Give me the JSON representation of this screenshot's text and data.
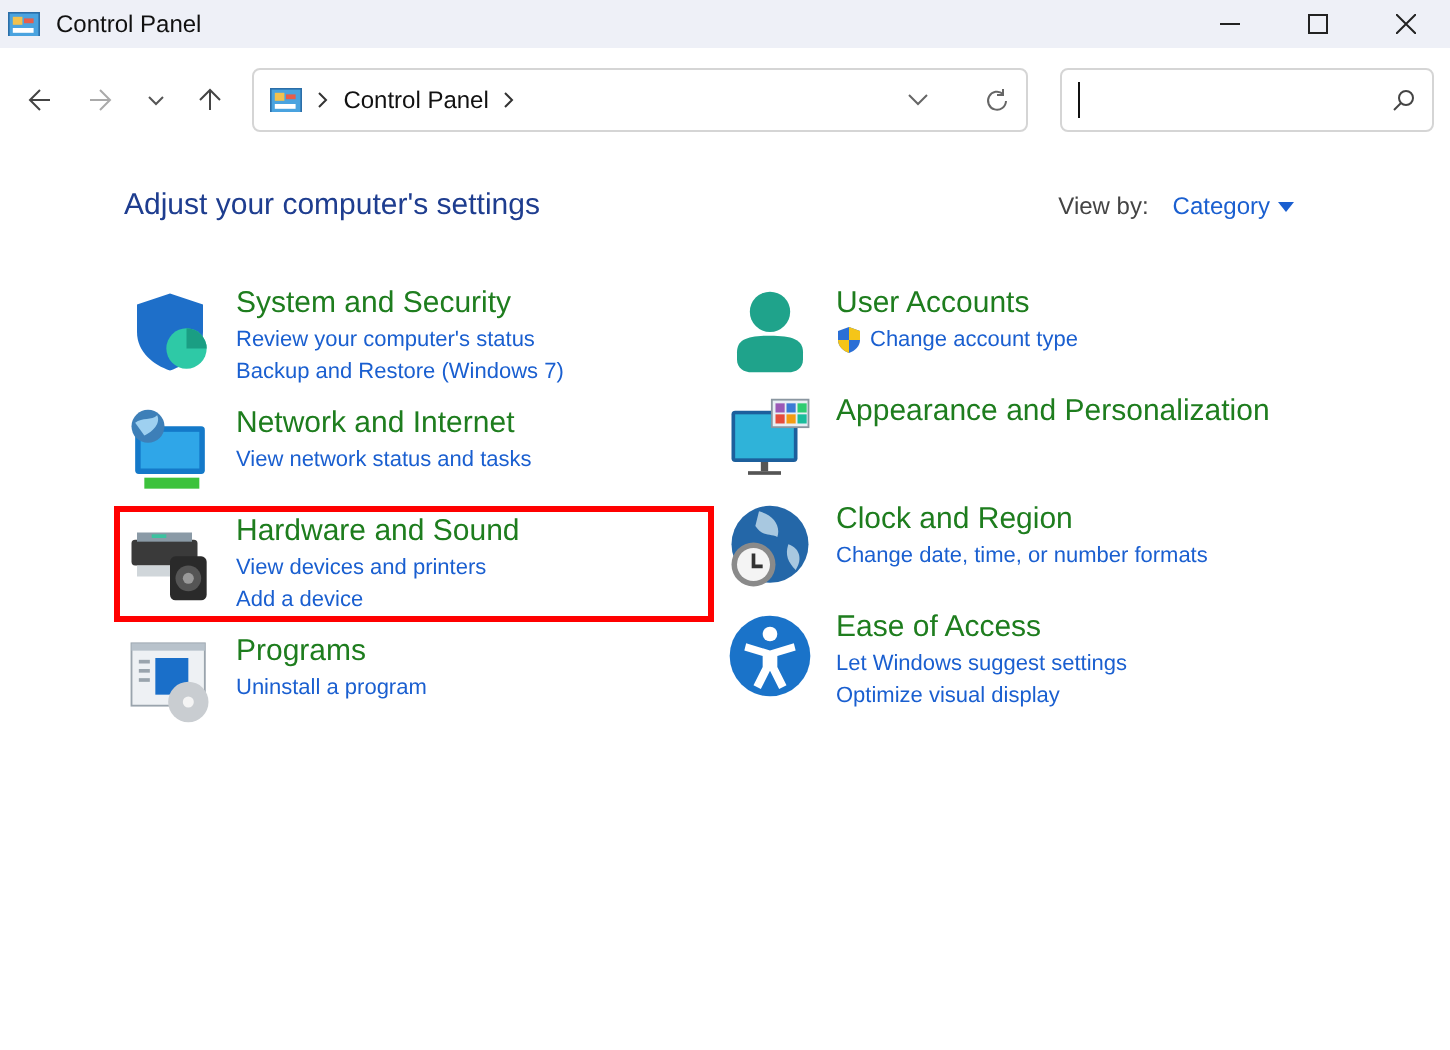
{
  "window": {
    "title": "Control Panel"
  },
  "address": {
    "crumbs": [
      "Control Panel"
    ]
  },
  "heading": "Adjust your computer's settings",
  "view_by": {
    "label": "View by:",
    "value": "Category"
  },
  "columns": [
    [
      {
        "kind": "security",
        "title": "System and Security",
        "highlighted": false,
        "links": [
          {
            "text": "Review your computer's status",
            "shield": false
          },
          {
            "text": "Backup and Restore (Windows 7)",
            "shield": false
          }
        ]
      },
      {
        "kind": "network",
        "title": "Network and Internet",
        "highlighted": false,
        "links": [
          {
            "text": "View network status and tasks",
            "shield": false
          }
        ]
      },
      {
        "kind": "hardware",
        "title": "Hardware and Sound",
        "highlighted": true,
        "links": [
          {
            "text": "View devices and printers",
            "shield": false
          },
          {
            "text": "Add a device",
            "shield": false
          }
        ]
      },
      {
        "kind": "programs",
        "title": "Programs",
        "highlighted": false,
        "links": [
          {
            "text": "Uninstall a program",
            "shield": false
          }
        ]
      }
    ],
    [
      {
        "kind": "user",
        "title": "User Accounts",
        "highlighted": false,
        "links": [
          {
            "text": "Change account type",
            "shield": true
          }
        ]
      },
      {
        "kind": "appearance",
        "title": "Appearance and Personalization",
        "highlighted": false
      },
      {
        "kind": "clock",
        "title": "Clock and Region",
        "highlighted": false,
        "links": [
          {
            "text": "Change date, time, or number formats",
            "shield": false
          }
        ]
      },
      {
        "kind": "access",
        "title": "Ease of Access",
        "highlighted": false,
        "links": [
          {
            "text": "Let Windows suggest settings",
            "shield": false
          },
          {
            "text": "Optimize visual display",
            "shield": false
          }
        ]
      }
    ]
  ]
}
